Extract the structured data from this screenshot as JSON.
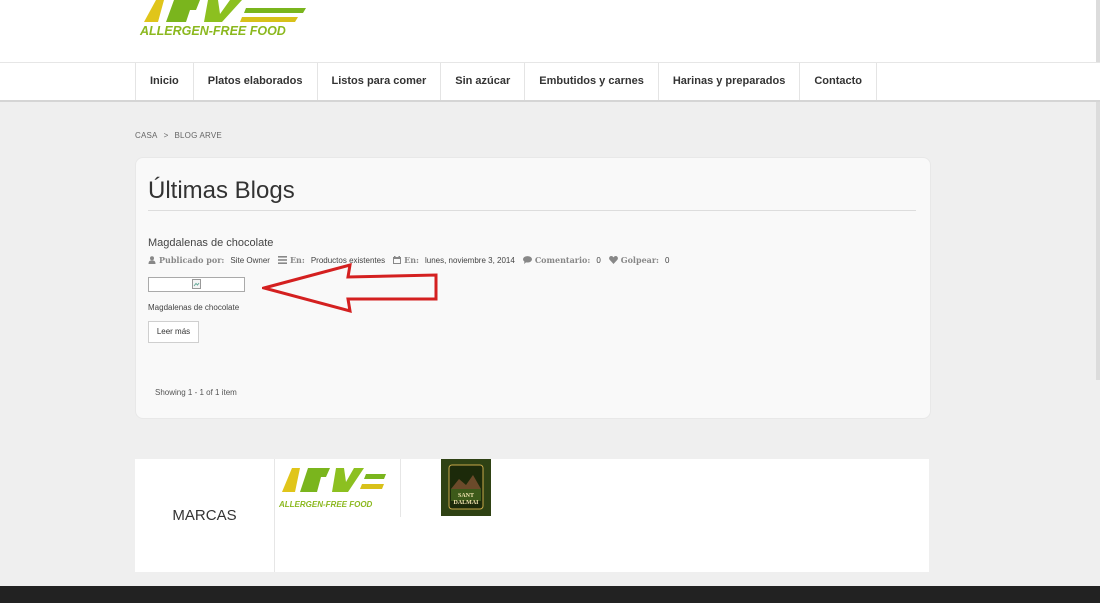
{
  "header": {
    "logo_text": "ARVE",
    "logo_tagline": "ALLERGEN-FREE FOOD"
  },
  "nav": {
    "items": [
      "Inicio",
      "Platos elaborados",
      "Listos para comer",
      "Sin azúcar",
      "Embutidos y carnes",
      "Harinas y preparados",
      "Contacto"
    ]
  },
  "breadcrumb": {
    "home": "CASA",
    "separator": ">",
    "current": "BLOG ARVE"
  },
  "main": {
    "title": "Últimas Blogs",
    "post": {
      "title": "Magdalenas de chocolate",
      "posted_by_label": "Publicado por:",
      "posted_by": "Site Owner",
      "category_label": "En:",
      "category": "Productos existentes",
      "date_label": "En:",
      "date": "lunes, noviembre 3, 2014",
      "comments_label": "Comentario:",
      "comments": "0",
      "hits_label": "Golpear:",
      "hits": "0",
      "excerpt": "Magdalenas de chocolate",
      "read_more": "Leer más"
    },
    "showing": "Showing 1 - 1 of 1 item"
  },
  "brands": {
    "label": "MARCAS",
    "items": [
      {
        "name": "ARVE",
        "tagline": "ALLERGEN-FREE FOOD"
      },
      {
        "name": "SANT DALMAI"
      }
    ]
  },
  "colors": {
    "logo_green": "#7ab51d",
    "logo_yellow": "#d8c11a",
    "arrow_red": "#d42020",
    "footer": "#222222"
  }
}
